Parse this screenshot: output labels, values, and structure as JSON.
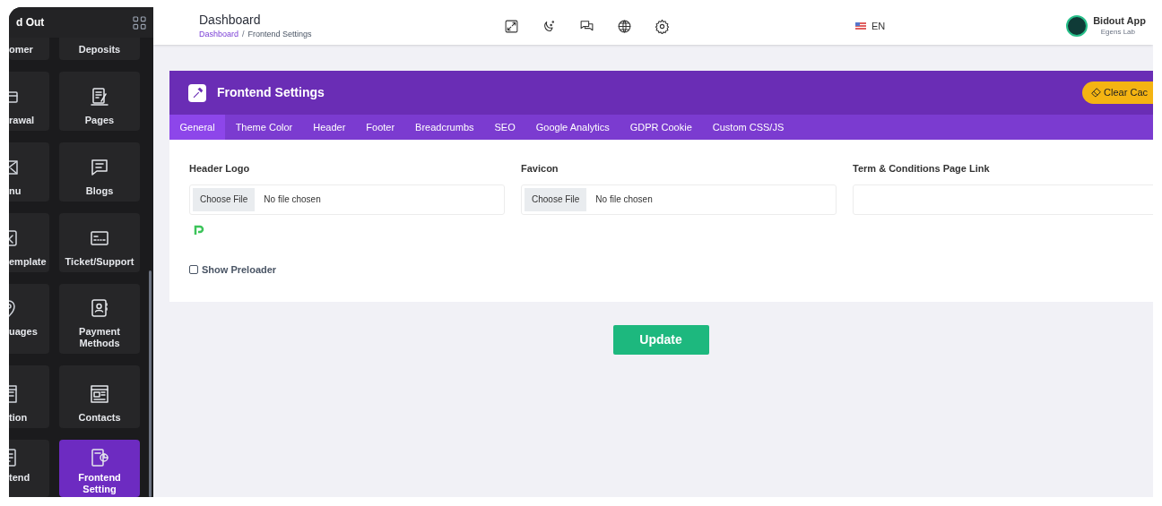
{
  "sidebar": {
    "title": "d Out",
    "items": [
      {
        "label": "omer",
        "selected": false
      },
      {
        "label": "Deposits",
        "selected": false
      },
      {
        "label": "rawal",
        "selected": false
      },
      {
        "label": "Pages",
        "selected": false
      },
      {
        "label": "nu",
        "selected": false
      },
      {
        "label": "Blogs",
        "selected": false
      },
      {
        "label": "emplate",
        "selected": false
      },
      {
        "label": "Ticket/Support",
        "selected": false
      },
      {
        "label": "uages",
        "selected": false
      },
      {
        "label": "Payment Methods",
        "selected": false
      },
      {
        "label": "tion",
        "selected": false
      },
      {
        "label": "Contacts",
        "selected": false
      },
      {
        "label": "tend",
        "selected": false
      },
      {
        "label": "Frontend Setting",
        "selected": true
      }
    ]
  },
  "header": {
    "title": "Dashboard",
    "separator": "/",
    "breadcrumbs": [
      {
        "label": "Dashboard",
        "kind": "link"
      },
      {
        "label": "Frontend Settings",
        "kind": "current"
      }
    ],
    "language": "EN",
    "user": {
      "name": "Bidout App",
      "subtitle": "Egens Lab"
    }
  },
  "panel": {
    "title": "Frontend Settings",
    "action": "Clear Cac",
    "tabs": [
      {
        "label": "General",
        "selected": true
      },
      {
        "label": "Theme Color",
        "selected": false
      },
      {
        "label": "Header",
        "selected": false
      },
      {
        "label": "Footer",
        "selected": false
      },
      {
        "label": "Breadcrumbs",
        "selected": false
      },
      {
        "label": "SEO",
        "selected": false
      },
      {
        "label": "Google Analytics",
        "selected": false
      },
      {
        "label": "GDPR Cookie",
        "selected": false
      },
      {
        "label": "Custom CSS/JS",
        "selected": false
      }
    ],
    "fields": [
      {
        "label": "Header Logo",
        "kind": "file",
        "button": "Choose File",
        "value": "No file chosen",
        "preview": true
      },
      {
        "label": "Favicon",
        "kind": "file",
        "button": "Choose File",
        "value": "No file chosen",
        "preview": false
      },
      {
        "label": "Term & Conditions Page Link",
        "kind": "text"
      }
    ],
    "checkbox": {
      "label": "Show Preloader",
      "checked": false
    }
  },
  "submit": "Update"
}
